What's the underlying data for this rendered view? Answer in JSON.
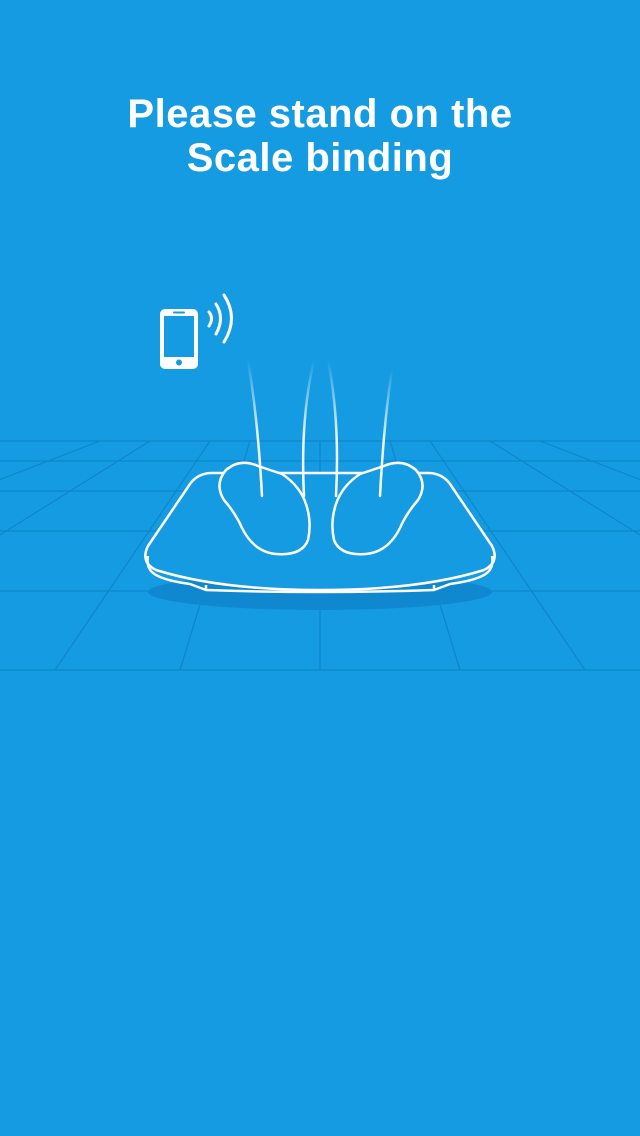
{
  "screen": {
    "background_color": "#159be2",
    "title_lines": [
      "Please stand on the",
      "Scale binding"
    ]
  },
  "illustration": {
    "phone_icon": "smartphone-icon",
    "signal_icon": "wireless-signal-icon",
    "scale_icon": "bathroom-scale-icon",
    "feet_icon": "feet-icon"
  },
  "colors": {
    "background": "#159be2",
    "line": "#ffffff",
    "grid": "#0f86c8",
    "shadow": "#1088cf"
  }
}
